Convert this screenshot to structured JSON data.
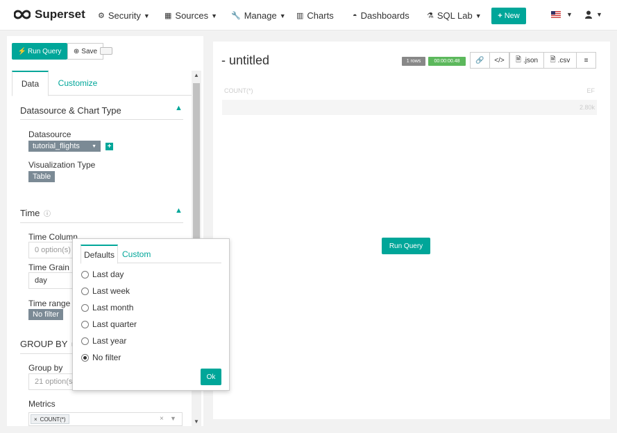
{
  "navbar": {
    "brand": "Superset",
    "items": [
      {
        "label": "Security",
        "icon": "cogs-icon"
      },
      {
        "label": "Sources",
        "icon": "table-icon"
      },
      {
        "label": "Manage",
        "icon": "wrench-icon"
      },
      {
        "label": "Charts",
        "icon": "bar-chart-icon"
      },
      {
        "label": "Dashboards",
        "icon": "dashboard-icon"
      },
      {
        "label": "SQL Lab",
        "icon": "flask-icon"
      }
    ],
    "new_label": "New"
  },
  "toolbar": {
    "run_label": "Run Query",
    "save_label": "Save"
  },
  "tabs": {
    "data": "Data",
    "customize": "Customize"
  },
  "datasource_section": {
    "title": "Datasource & Chart Type",
    "datasource_label": "Datasource",
    "datasource_value": "tutorial_flights",
    "viz_label": "Visualization Type",
    "viz_value": "Table"
  },
  "time_section": {
    "title": "Time",
    "time_column_label": "Time Column",
    "time_column_placeholder": "0 option(s)",
    "time_grain_label": "Time Grain",
    "time_grain_value": "day",
    "time_range_label": "Time range",
    "time_range_value": "No filter"
  },
  "groupby_section": {
    "title": "GROUP BY",
    "group_by_label": "Group by",
    "group_by_placeholder": "21 option(s)",
    "metrics_label": "Metrics",
    "metric_tag": "COUNT(*)"
  },
  "result": {
    "title": "- untitled",
    "rows_badge": "1 rows",
    "time_badge": "00:00:00.48",
    "json_label": ".json",
    "csv_label": ".csv",
    "column_left": "COUNT(*)",
    "column_right": "EF",
    "row_value": "2.80k",
    "run_label": "Run Query"
  },
  "popover": {
    "tab_defaults": "Defaults",
    "tab_custom": "Custom",
    "options": [
      "Last day",
      "Last week",
      "Last month",
      "Last quarter",
      "Last year",
      "No filter"
    ],
    "selected": "No filter",
    "ok_label": "Ok"
  },
  "colors": {
    "accent": "#00a699",
    "tag": "#7b8a95",
    "success": "#5cb85c"
  }
}
